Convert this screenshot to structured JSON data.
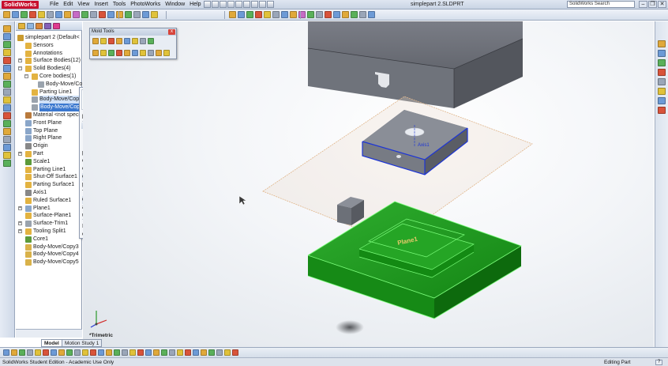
{
  "app": {
    "logo": "SolidWorks",
    "document_title": "simplepart 2.SLDPRT",
    "search_placeholder": "SolidWorks Search",
    "menu": [
      "File",
      "Edit",
      "View",
      "Insert",
      "Tools",
      "PhotoWorks",
      "Window",
      "Help"
    ],
    "window_controls": [
      "–",
      "❐",
      "✕"
    ]
  },
  "feature_tree": {
    "items": [
      {
        "label": "simplepart 2  (Default<",
        "icon": "part-icon",
        "color": "#c99a2e"
      },
      {
        "label": "Sensors",
        "icon": "sensor-folder-icon",
        "color": "#e3b341"
      },
      {
        "label": "Annotations",
        "icon": "annotations-icon",
        "color": "#e3b341"
      },
      {
        "label": "Surface Bodies(12)",
        "icon": "surface-bodies-folder-icon",
        "color": "#e3b341"
      },
      {
        "label": "Solid Bodies(4)",
        "icon": "solid-bodies-folder-icon",
        "color": "#e3b341"
      },
      {
        "label": "Core bodies(1)",
        "icon": "folder-icon",
        "color": "#e3b341"
      },
      {
        "label": "Body-Move/Co",
        "icon": "body-icon",
        "color": "#9aa3ad"
      },
      {
        "label": "Parting Line1",
        "icon": "parting-line-icon",
        "color": "#e3b341"
      },
      {
        "label": "Body-Move/Copy",
        "icon": "body-icon",
        "color": "#9aa3ad"
      },
      {
        "label": "Body-Move/Copy",
        "icon": "body-icon",
        "color": "#9aa3ad"
      },
      {
        "label": "Material <not specifi",
        "icon": "material-icon",
        "color": "#b97a3c"
      },
      {
        "label": "Front Plane",
        "icon": "plane-icon",
        "color": "#8aa6c9"
      },
      {
        "label": "Top Plane",
        "icon": "plane-icon",
        "color": "#8aa6c9"
      },
      {
        "label": "Right Plane",
        "icon": "plane-icon",
        "color": "#8aa6c9"
      },
      {
        "label": "Origin",
        "icon": "origin-icon",
        "color": "#888888"
      },
      {
        "label": "Part",
        "icon": "folder-icon",
        "color": "#e3b341"
      },
      {
        "label": "Scale1",
        "icon": "scale-icon",
        "color": "#5c9a3a"
      },
      {
        "label": "Parting Line1",
        "icon": "parting-line-icon",
        "color": "#e3b341"
      },
      {
        "label": "Shut-Off Surface1",
        "icon": "shutoff-surface-icon",
        "color": "#e3b341"
      },
      {
        "label": "Parting Surface1",
        "icon": "parting-surface-icon",
        "color": "#e3b341"
      },
      {
        "label": "Axis1",
        "icon": "axis-icon",
        "color": "#888888"
      },
      {
        "label": "Ruled Surface1",
        "icon": "ruled-surface-icon",
        "color": "#e3b341"
      },
      {
        "label": "Plane1",
        "icon": "plane-icon",
        "color": "#8aa6c9"
      },
      {
        "label": "Surface-Plane1",
        "icon": "surface-plane-icon",
        "color": "#e3b341"
      },
      {
        "label": "Surface-Trim1",
        "icon": "surface-trim-icon",
        "color": "#9aa3ad"
      },
      {
        "label": "Tooling Split1",
        "icon": "tooling-split-icon",
        "color": "#e3b341"
      },
      {
        "label": "Core1",
        "icon": "core-icon",
        "color": "#5c9a3a"
      },
      {
        "label": "Body-Move/Copy3",
        "icon": "move-copy-icon",
        "color": "#d9b24a"
      },
      {
        "label": "Body-Move/Copy4",
        "icon": "move-copy-icon",
        "color": "#d9b24a"
      },
      {
        "label": "Body-Move/Copy5",
        "icon": "move-copy-icon",
        "color": "#d9b24a"
      }
    ]
  },
  "context_menu": {
    "items": [
      "lection",
      "play",
      "ody...",
      "ew Folder",
      "o New Part...",
      "perties...",
      "Transparency",
      "dy-Move/Copy5)",
      "ature (in Tree)",
      "uild...",
      "Items",
      "e Menu"
    ]
  },
  "mold_tools": {
    "title": "Mold Tools",
    "close": "x"
  },
  "viewport": {
    "view_label": "*Trimetric",
    "plane_label": "Plane1",
    "axis_label": "Axis1",
    "core_color": "#1f9a1f",
    "cavity_color": "#6d7079"
  },
  "tabs": {
    "model": "Model",
    "motion": "Motion Study 1"
  },
  "status": {
    "left": "SolidWorks Student Edition - Academic Use Only",
    "right": "Editing Part",
    "help": "?"
  }
}
